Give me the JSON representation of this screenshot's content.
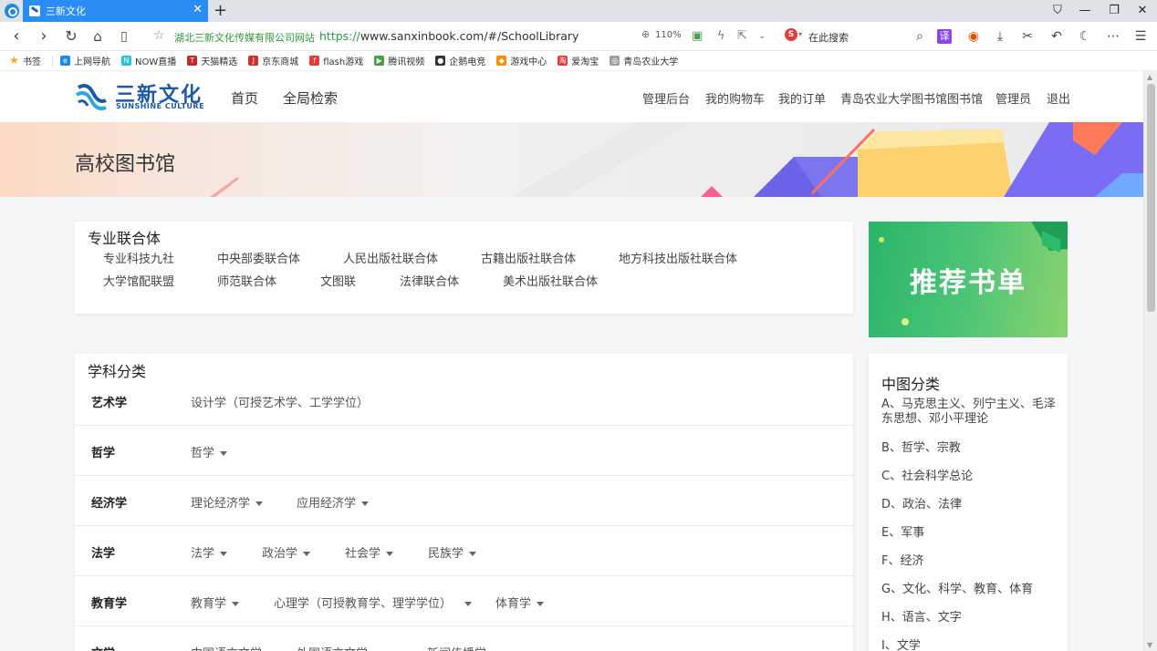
{
  "browser": {
    "tab_title": "三新文化",
    "site_name": "湖北三新文化传媒有限公司网站",
    "url_proto": "https://",
    "url_rest": "www.sanxinbook.com/#/SchoolLibrary",
    "zoom": "110%",
    "search_placeholder": "在此搜索",
    "bookmarks": [
      {
        "label": "书签",
        "color": "#f5a623",
        "icon": "star-icon"
      },
      {
        "label": "上网导航",
        "color": "#1e88e5",
        "icon": "ie-icon"
      },
      {
        "label": "NOW直播",
        "color": "#26c6da",
        "icon": "now-icon"
      },
      {
        "label": "天猫精选",
        "color": "#c62828",
        "icon": "tmall-icon"
      },
      {
        "label": "京东商城",
        "color": "#d32f2f",
        "icon": "jd-icon"
      },
      {
        "label": "flash游戏",
        "color": "#e53935",
        "icon": "flash-icon"
      },
      {
        "label": "腾讯视频",
        "color": "#43a047",
        "icon": "video-icon"
      },
      {
        "label": "企鹅电竞",
        "color": "#333333",
        "icon": "penguin-icon"
      },
      {
        "label": "游戏中心",
        "color": "#fb8c00",
        "icon": "game-icon"
      },
      {
        "label": "爱淘宝",
        "color": "#e53935",
        "icon": "taobao-icon"
      },
      {
        "label": "青岛农业大学",
        "color": "#9e9e9e",
        "icon": "globe-icon"
      }
    ]
  },
  "header": {
    "logo_cn": "三新文化",
    "logo_en": "SUNSHINE CULTURE",
    "nav": [
      "首页",
      "全局检索"
    ],
    "right_nav": [
      "管理后台",
      "我的购物车",
      "我的订单",
      "青岛农业大学图书馆图书馆",
      "管理员",
      "退出"
    ]
  },
  "banner": {
    "title": "高校图书馆"
  },
  "unions": {
    "title": "专业联合体",
    "row1": [
      "专业科技九社",
      "中央部委联合体",
      "人民出版社联合体",
      "古籍出版社联合体",
      "地方科技出版社联合体"
    ],
    "row2": [
      "大学馆配联盟",
      "师范联合体",
      "文图联",
      "法律联合体",
      "美术出版社联合体"
    ]
  },
  "recommend": {
    "label": "推荐书单"
  },
  "subjects": {
    "title": "学科分类",
    "rows": [
      {
        "name": "艺术学",
        "items": [
          {
            "label": "设计学（可授艺术学、工学学位）",
            "dropdown": false
          }
        ]
      },
      {
        "name": "哲学",
        "items": [
          {
            "label": "哲学",
            "dropdown": true
          }
        ]
      },
      {
        "name": "经济学",
        "items": [
          {
            "label": "理论经济学",
            "dropdown": true
          },
          {
            "label": "应用经济学",
            "dropdown": true
          }
        ]
      },
      {
        "name": "法学",
        "items": [
          {
            "label": "法学",
            "dropdown": true
          },
          {
            "label": "政治学",
            "dropdown": true
          },
          {
            "label": "社会学",
            "dropdown": true
          },
          {
            "label": "民族学",
            "dropdown": true
          }
        ]
      },
      {
        "name": "教育学",
        "items": [
          {
            "label": "教育学",
            "dropdown": true
          },
          {
            "label": "心理学（可授教育学、理学学位）",
            "dropdown": true
          },
          {
            "label": "体育学",
            "dropdown": true
          }
        ]
      },
      {
        "name": "文学",
        "items": [
          {
            "label": "中国语言文学",
            "dropdown": true
          },
          {
            "label": "外国语言文学",
            "dropdown": true
          },
          {
            "label": "新闻传播学",
            "dropdown": true
          }
        ]
      }
    ]
  },
  "zhongtu": {
    "title": "中图分类",
    "items": [
      "A、马克思主义、列宁主义、毛泽东思想、邓小平理论",
      "B、哲学、宗教",
      "C、社会科学总论",
      "D、政治、法律",
      "E、军事",
      "F、经济",
      "G、文化、科学、教育、体育",
      "H、语言、文字",
      "I、文学"
    ]
  }
}
